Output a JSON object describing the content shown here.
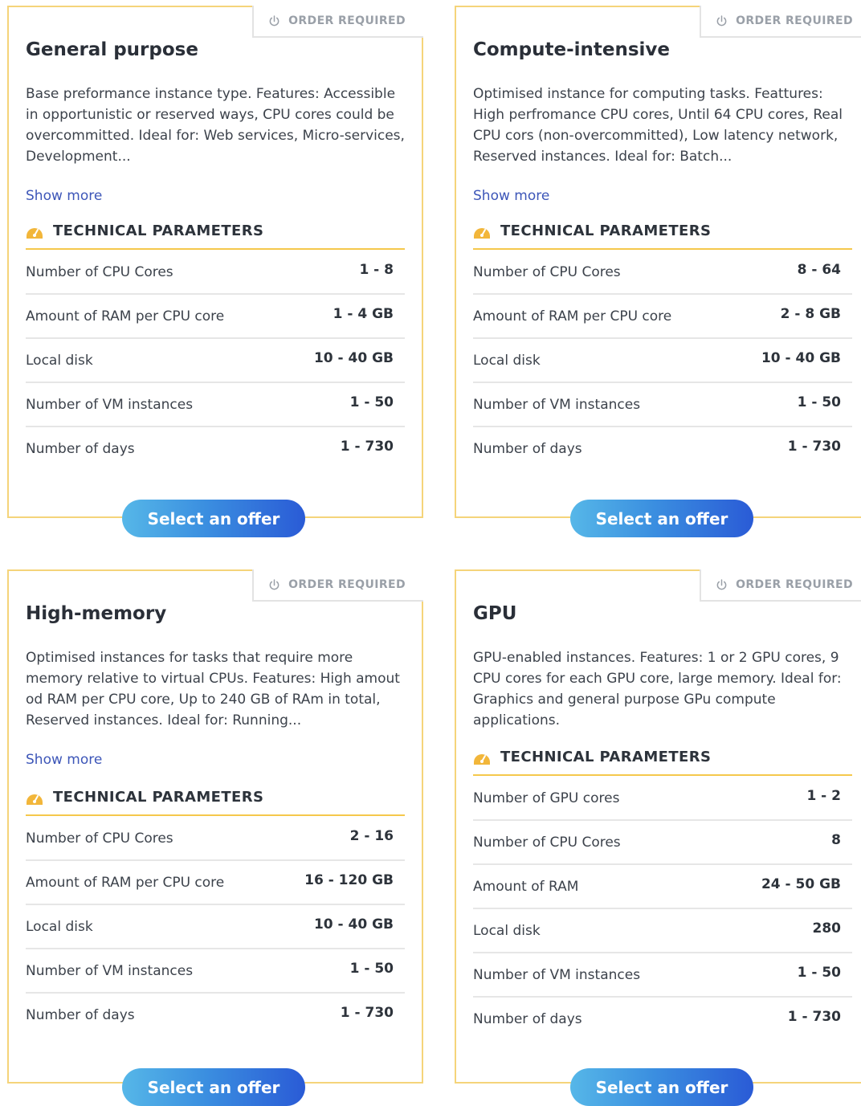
{
  "badge_label": "ORDER REQUIRED",
  "show_more_label": "Show more",
  "tech_params_label": "TECHNICAL PARAMETERS",
  "select_label": "Select an offer",
  "colors": {
    "card_border": "#f5d47a",
    "accent": "#f5c84c",
    "button_start": "#56b7e8",
    "button_end": "#2a5bd6",
    "link": "#3d56b8"
  },
  "cards": [
    {
      "title": "General purpose",
      "description": "Base preformance instance type. Features: Accessible in opportunistic or reserved ways, CPU cores could be overcommitted. Ideal for: Web services, Micro-services, Development...",
      "params": [
        {
          "label": "Number of CPU Cores",
          "value": "1 - 8"
        },
        {
          "label": "Amount of RAM per CPU core",
          "value": "1 - 4 GB"
        },
        {
          "label": "Local disk",
          "value": "10 - 40 GB"
        },
        {
          "label": "Number of VM instances",
          "value": "1 - 50"
        },
        {
          "label": "Number of days",
          "value": "1 - 730"
        }
      ]
    },
    {
      "title": "Compute-intensive",
      "description": "Optimised instance for computing tasks. Feattures: High perfromance CPU cores, Until 64 CPU cores, Real CPU cors (non-overcommitted), Low latency network, Reserved instances. Ideal for: Batch...",
      "params": [
        {
          "label": "Number of CPU Cores",
          "value": "8 - 64"
        },
        {
          "label": "Amount of RAM per CPU core",
          "value": "2 - 8 GB"
        },
        {
          "label": "Local disk",
          "value": "10 - 40 GB"
        },
        {
          "label": "Number of VM instances",
          "value": "1 - 50"
        },
        {
          "label": "Number of days",
          "value": "1 - 730"
        }
      ]
    },
    {
      "title": "High-memory",
      "description": "Optimised instances for tasks that require more memory relative to virtual CPUs. Features: High amout od RAM per CPU core, Up to 240 GB of RAm in total, Reserved instances. Ideal for: Running...",
      "params": [
        {
          "label": "Number of CPU Cores",
          "value": "2 - 16"
        },
        {
          "label": "Amount of RAM per CPU core",
          "value": "16 - 120 GB"
        },
        {
          "label": "Local disk",
          "value": "10 - 40 GB"
        },
        {
          "label": "Number of VM instances",
          "value": "1 - 50"
        },
        {
          "label": "Number of days",
          "value": "1 - 730"
        }
      ]
    },
    {
      "title": "GPU",
      "description": "GPU-enabled instances. Features: 1 or 2 GPU cores, 9 CPU cores for each GPU core, large memory. Ideal for: Graphics and general purpose GPu compute applications.",
      "params": [
        {
          "label": "Number of GPU cores",
          "value": "1 - 2"
        },
        {
          "label": "Number of CPU Cores",
          "value": "8"
        },
        {
          "label": "Amount of RAM",
          "value": "24 - 50 GB"
        },
        {
          "label": "Local disk",
          "value": "280"
        },
        {
          "label": "Number of VM instances",
          "value": "1 - 50"
        },
        {
          "label": "Number of days",
          "value": "1 - 730"
        }
      ]
    }
  ]
}
